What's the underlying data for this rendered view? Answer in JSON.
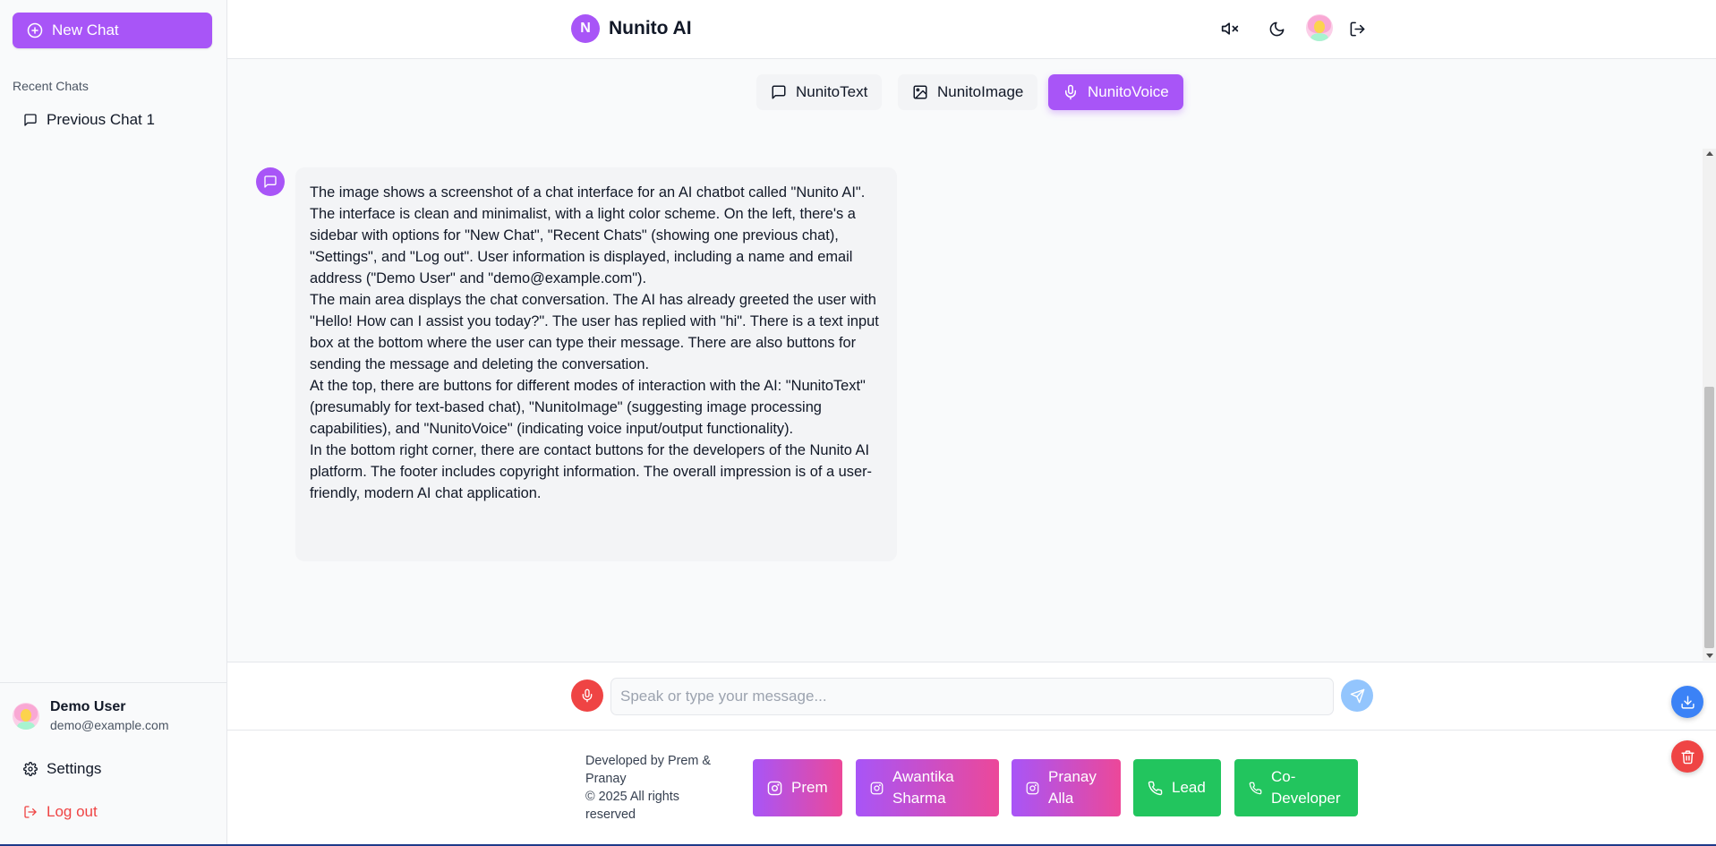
{
  "sidebar": {
    "new_chat_label": "New Chat",
    "recent_label": "Recent Chats",
    "chats": [
      {
        "label": "Previous Chat 1"
      }
    ],
    "user": {
      "name": "Demo User",
      "email": "demo@example.com"
    },
    "settings_label": "Settings",
    "logout_label": "Log out"
  },
  "header": {
    "brand_initial": "N",
    "brand_title": "Nunito AI",
    "icons": [
      "volume-mute-icon",
      "moon-icon",
      "user-avatar",
      "logout-icon"
    ]
  },
  "modes": [
    {
      "label": "NunitoText",
      "icon": "message-square-icon",
      "active": false
    },
    {
      "label": "NunitoImage",
      "icon": "image-icon",
      "active": false
    },
    {
      "label": "NunitoVoice",
      "icon": "mic-icon",
      "active": true
    }
  ],
  "message": {
    "paragraphs": [
      "The image shows a screenshot of a chat interface for an AI chatbot called \"Nunito AI\".",
      "The interface is clean and minimalist, with a light color scheme. On the left, there's a sidebar with options for \"New Chat\", \"Recent Chats\" (showing one previous chat), \"Settings\", and \"Log out\". User information is displayed, including a name and email address (\"Demo User\" and \"demo@example.com\").",
      "The main area displays the chat conversation. The AI has already greeted the user with \"Hello! How can I assist you today?\". The user has replied with \"hi\". There is a text input box at the bottom where the user can type their message. There are also buttons for sending the message and deleting the conversation.",
      "At the top, there are buttons for different modes of interaction with the AI: \"NunitoText\" (presumably for text-based chat), \"NunitoImage\" (suggesting image processing capabilities), and \"NunitoVoice\" (indicating voice input/output functionality).",
      "In the bottom right corner, there are contact buttons for the developers of the Nunito AI platform. The footer includes copyright information. The overall impression is of a user-friendly, modern AI chat application."
    ]
  },
  "input": {
    "placeholder": "Speak or type your message...",
    "value": ""
  },
  "footer": {
    "credits_line1": "Developed by Prem & Pranay",
    "credits_line2": "© 2025 All rights reserved",
    "contacts": [
      {
        "label": "Prem",
        "icon": "instagram-icon",
        "style": "gradient"
      },
      {
        "label": "Awantika Sharma",
        "icon": "instagram-icon",
        "style": "gradient"
      },
      {
        "label": "Pranay Alla",
        "icon": "instagram-icon",
        "style": "gradient"
      },
      {
        "label": "Lead",
        "icon": "phone-icon",
        "style": "green"
      },
      {
        "label": "Co-Developer",
        "icon": "phone-icon",
        "style": "green"
      }
    ]
  },
  "colors": {
    "accent": "#a855f7",
    "danger": "#ef4444",
    "send": "#93c5fd",
    "download": "#3b82f6",
    "contact_green": "#22c55e",
    "contact_gradient_end": "#ec4899"
  }
}
